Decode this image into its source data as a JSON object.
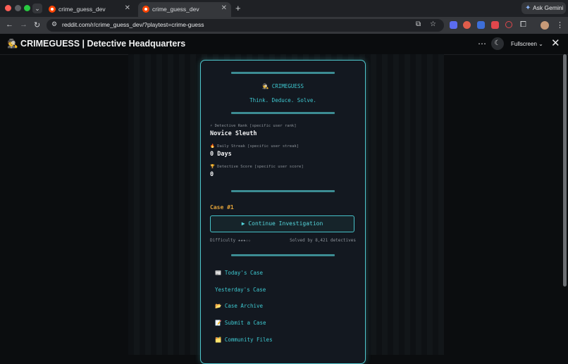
{
  "browser": {
    "tabs": [
      {
        "label": "crime_guess_dev"
      },
      {
        "label": "crime_guess_dev"
      }
    ],
    "url": "reddit.com/r/crime_guess_dev/?playtest=crime-guess",
    "ask_gemini": "Ask Gemini"
  },
  "app_header": {
    "title": "🕵️ CRIMEGUESS | Detective Headquarters",
    "fullscreen": "Fullscreen"
  },
  "card": {
    "brand": "🕵️ CRIMEGUESS",
    "tagline": "Think. Deduce. Solve.",
    "stats": [
      {
        "label": "⚡ Detective Rank [specific user rank]",
        "value": "Novice Sleuth"
      },
      {
        "label": "🔥 Daily Streak [specific user streak]",
        "value": "0 Days"
      },
      {
        "label": "🏆 Detective Score [specific user score]",
        "value": "0"
      }
    ],
    "case_title": "Case #1",
    "continue_button": "▶ Continue Investigation",
    "difficulty": "Difficulty ★★★☆☆",
    "solved_by": "Solved by 8,421 detectives",
    "menu": [
      "📰 Today's Case",
      "Yesterday's Case",
      "📂 Case Archive",
      "📝 Submit a Case",
      "🗂️ Community Files"
    ]
  },
  "colors": {
    "accent": "#3ec8d0",
    "case_title": "#e3a33a",
    "card_bg": "#131820",
    "page_bg": "#0b0d0f"
  }
}
